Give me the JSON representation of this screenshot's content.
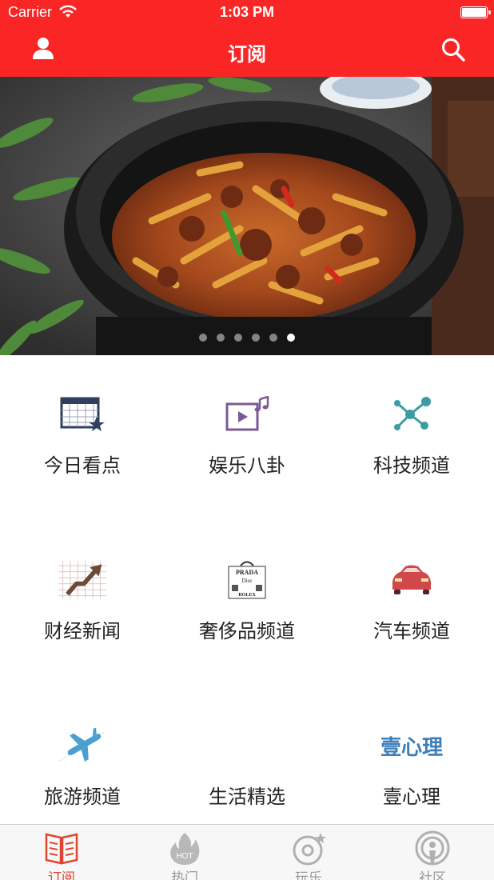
{
  "status_bar": {
    "carrier": "Carrier",
    "time": "1:03 PM"
  },
  "nav": {
    "title": "订阅",
    "left_icon": "user-icon",
    "right_icon": "search-icon"
  },
  "carousel": {
    "page_count": 6,
    "active_page": 6
  },
  "channels": [
    {
      "label": "今日看点",
      "icon": "calendar-star-icon"
    },
    {
      "label": "娱乐八卦",
      "icon": "video-music-icon"
    },
    {
      "label": "科技频道",
      "icon": "network-nodes-icon"
    },
    {
      "label": "财经新闻",
      "icon": "rising-chart-icon"
    },
    {
      "label": "奢侈品频道",
      "icon": "luxury-brands-icon",
      "logo_words": [
        "PRADA",
        "Dior",
        "ROLEX"
      ]
    },
    {
      "label": "汽车频道",
      "icon": "car-icon"
    },
    {
      "label": "旅游频道",
      "icon": "airplane-icon"
    },
    {
      "label": "生活精选",
      "icon": ""
    },
    {
      "label": "壹心理",
      "icon": "xinli-logo",
      "logo_text": "壹心理"
    }
  ],
  "tabbar": {
    "tabs": [
      {
        "label": "订阅",
        "icon": "book-icon",
        "active": true
      },
      {
        "label": "热门",
        "icon": "hot-flame-icon",
        "badge": "HOT",
        "active": false
      },
      {
        "label": "玩乐",
        "icon": "disc-icon",
        "active": false
      },
      {
        "label": "社区",
        "icon": "podcast-icon",
        "active": false
      }
    ]
  },
  "colors": {
    "nav_bg": "#fa2626",
    "tab_active": "#e2442f",
    "tab_inactive": "#9a9a9a"
  }
}
